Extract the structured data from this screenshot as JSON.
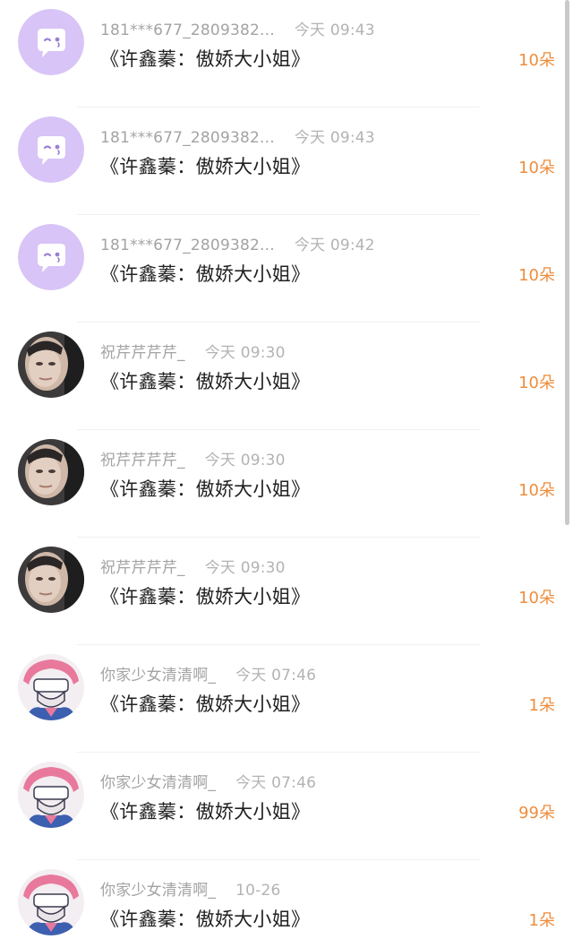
{
  "records": [
    {
      "avatar": "chat-bubble-icon",
      "user": "181***677_2809382...",
      "time": "今天 09:43",
      "gift": "《许鑫蓁：傲娇大小姐》",
      "count": "10朵"
    },
    {
      "avatar": "chat-bubble-icon",
      "user": "181***677_2809382...",
      "time": "今天 09:43",
      "gift": "《许鑫蓁：傲娇大小姐》",
      "count": "10朵"
    },
    {
      "avatar": "chat-bubble-icon",
      "user": "181***677_2809382...",
      "time": "今天 09:42",
      "gift": "《许鑫蓁：傲娇大小姐》",
      "count": "10朵"
    },
    {
      "avatar": "user-photo",
      "user": "祝芹芹芹芹_",
      "time": "今天 09:30",
      "gift": "《许鑫蓁：傲娇大小姐》",
      "count": "10朵"
    },
    {
      "avatar": "user-photo",
      "user": "祝芹芹芹芹_",
      "time": "今天 09:30",
      "gift": "《许鑫蓁：傲娇大小姐》",
      "count": "10朵"
    },
    {
      "avatar": "user-photo",
      "user": "祝芹芹芹芹_",
      "time": "今天 09:30",
      "gift": "《许鑫蓁：傲娇大小姐》",
      "count": "10朵"
    },
    {
      "avatar": "anime-avatar",
      "user": "你家少女清清啊_",
      "time": "今天 07:46",
      "gift": "《许鑫蓁：傲娇大小姐》",
      "count": "1朵"
    },
    {
      "avatar": "anime-avatar",
      "user": "你家少女清清啊_",
      "time": "今天 07:46",
      "gift": "《许鑫蓁：傲娇大小姐》",
      "count": "99朵"
    },
    {
      "avatar": "anime-avatar",
      "user": "你家少女清清啊_",
      "time": "10-26",
      "gift": "《许鑫蓁：傲娇大小姐》",
      "count": "1朵"
    }
  ],
  "colors": {
    "username": "#a3a3a3",
    "gift_title": "#222222",
    "count": "#ef8d3c",
    "default_avatar_bg": "#d8c4f6"
  }
}
